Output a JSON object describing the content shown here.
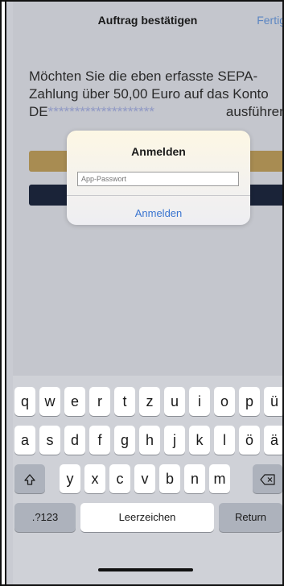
{
  "navbar": {
    "title": "Auftrag bestätigen",
    "done_label": "Fertig"
  },
  "message": {
    "line1": "Möchten Sie die eben erfasste SEPA-",
    "line2": "Zahlung über 50,00 Euro auf das Konto",
    "iban_prefix": "DE",
    "iban_mask": "********************",
    "line3_end": "ausführen?"
  },
  "dialog": {
    "title": "Anmelden",
    "password_placeholder": "App-Passwort",
    "action_label": "Anmelden"
  },
  "keyboard": {
    "row1": [
      "q",
      "w",
      "e",
      "r",
      "t",
      "z",
      "u",
      "i",
      "o",
      "p",
      "ü"
    ],
    "row2": [
      "a",
      "s",
      "d",
      "f",
      "g",
      "h",
      "j",
      "k",
      "l",
      "ö",
      "ä"
    ],
    "row3": [
      "y",
      "x",
      "c",
      "v",
      "b",
      "n",
      "m"
    ],
    "shift_icon": "shift-arrow-icon",
    "backspace_icon": "backspace-icon",
    "numbers_label": ".?123",
    "space_label": "Leerzeichen",
    "return_label": "Return"
  },
  "colors": {
    "accent": "#3a74d0",
    "gold_button": "#a88c52",
    "navy_button": "#1a2338"
  }
}
